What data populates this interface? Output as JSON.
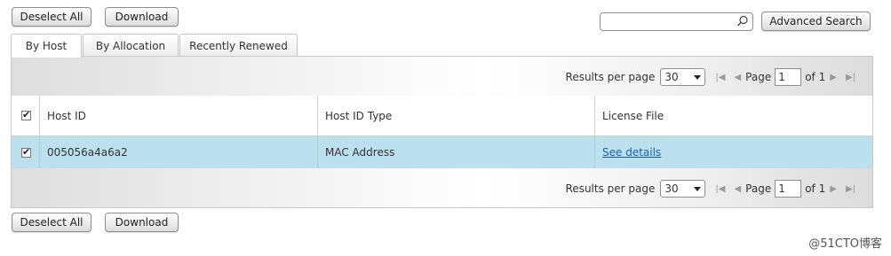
{
  "toolbar_top": {
    "deselect_all": "Deselect All",
    "download": "Download"
  },
  "search": {
    "placeholder": "",
    "advanced_label": "Advanced Search"
  },
  "tabs": [
    {
      "label": "By Host"
    },
    {
      "label": "By Allocation"
    },
    {
      "label": "Recently Renewed"
    }
  ],
  "pager": {
    "results_label": "Results per page",
    "per_page": "30",
    "page_label": "Page",
    "page_value": "1",
    "of_label": "of 1"
  },
  "table": {
    "columns": [
      "Host ID",
      "Host ID Type",
      "License File"
    ],
    "rows": [
      {
        "host_id": "005056a4a6a2",
        "host_type": "MAC Address",
        "license": "See details"
      }
    ],
    "row_selected_color": "#bde0ee",
    "link_color": "#1a5fb4"
  },
  "toolbar_bottom": {
    "deselect_all": "Deselect All",
    "download": "Download"
  },
  "watermark": "@51CTO博客"
}
